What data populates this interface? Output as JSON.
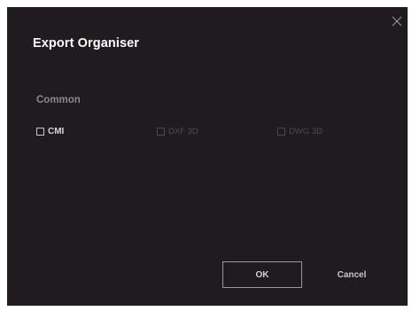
{
  "dialog": {
    "title": "Export Organiser",
    "close_icon": "close-icon"
  },
  "section": {
    "label": "Common"
  },
  "options": [
    {
      "label": "CMI",
      "checked": false,
      "enabled": true
    },
    {
      "label": "DXF 3D",
      "checked": false,
      "enabled": false
    },
    {
      "label": "DWG 3D",
      "checked": false,
      "enabled": false
    }
  ],
  "buttons": {
    "ok_label": "OK",
    "cancel_label": "Cancel"
  },
  "colors": {
    "background": "#1f1b1e",
    "title": "#ffffff",
    "section_label": "#8b878a",
    "disabled_text": "#4e4a4e",
    "button_border": "#9a979a"
  }
}
